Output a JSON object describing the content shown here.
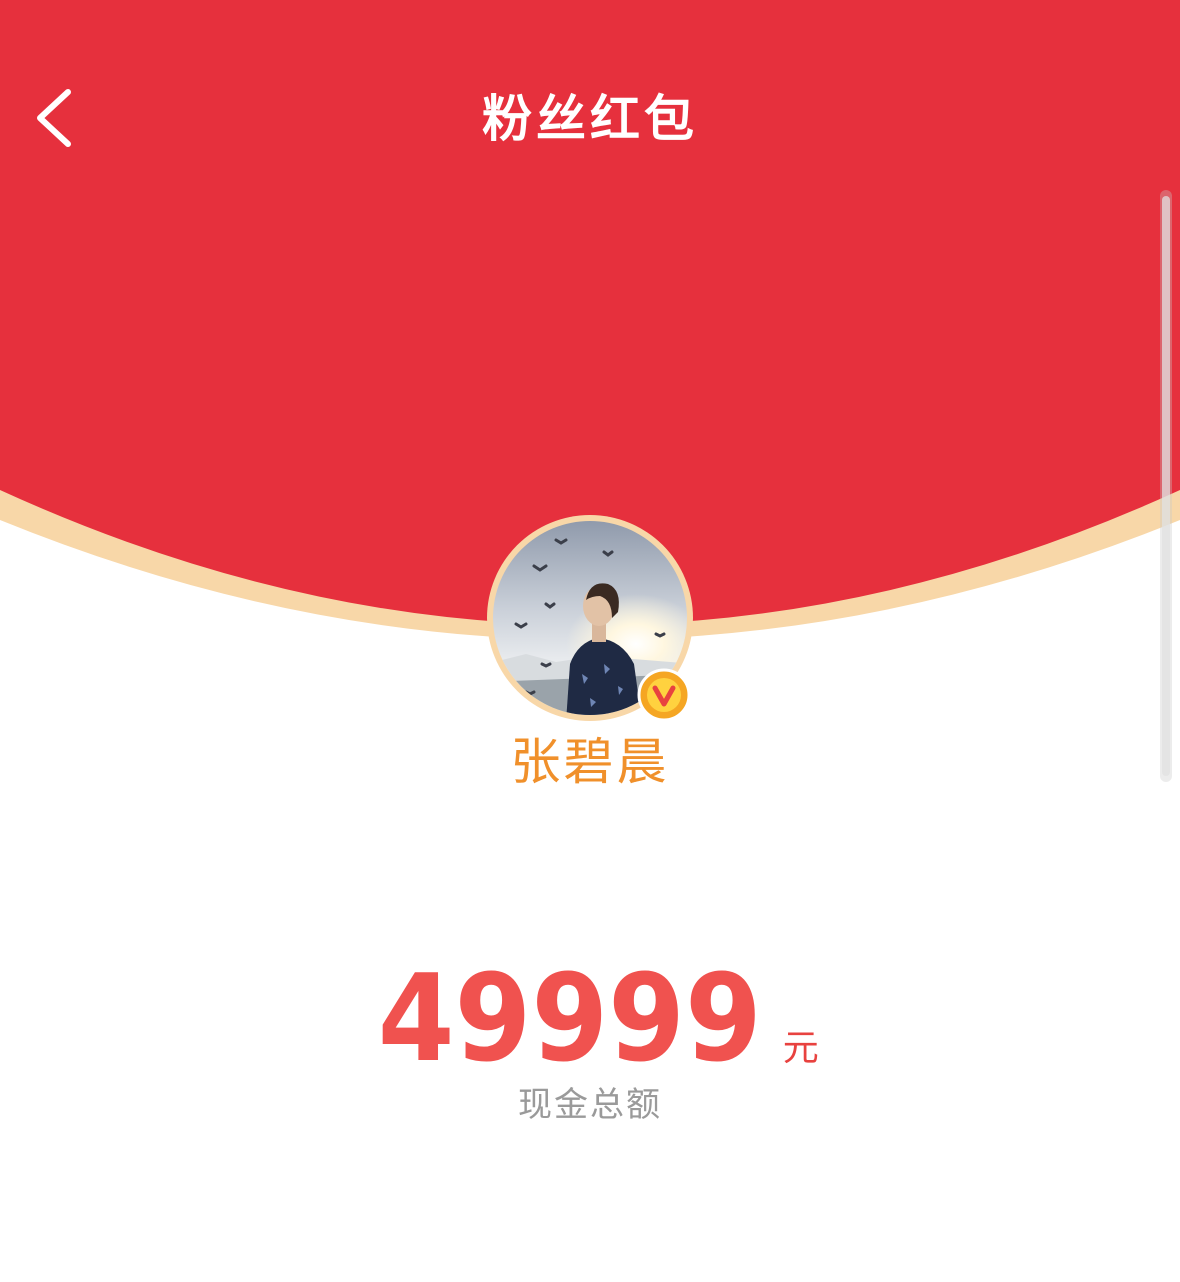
{
  "header": {
    "title": "粉丝红包",
    "back_icon": "chevron-left-icon"
  },
  "user": {
    "name": "张碧晨",
    "verified_icon": "verified-v-badge-icon",
    "avatar": "avatar-photo"
  },
  "amount": {
    "value": "49999",
    "unit": "元",
    "label": "现金总额"
  },
  "colors": {
    "envelope_red": "#e6303d",
    "gold_rim": "#f8d7a8",
    "name_orange": "#f0902b",
    "amount_red": "#f0524f",
    "label_gray": "#9a9a9a",
    "badge_orange": "#f5a623"
  }
}
